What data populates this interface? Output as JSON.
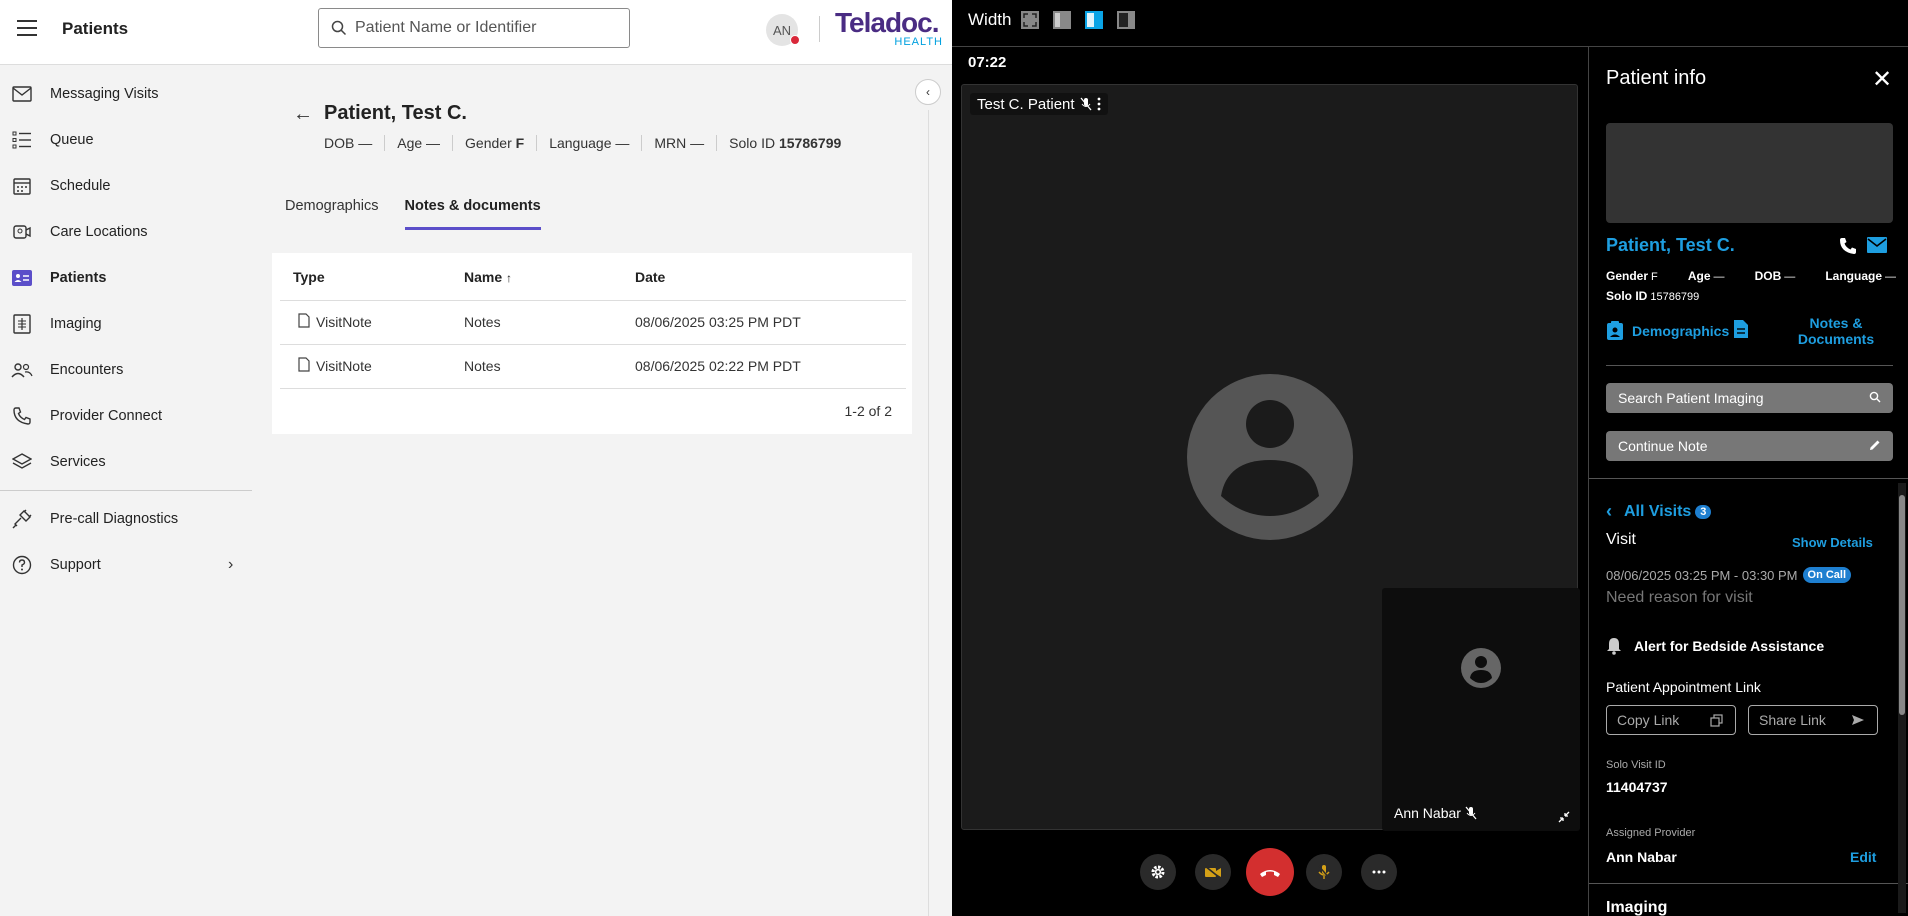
{
  "header": {
    "title": "Patients",
    "search_placeholder": "Patient Name or Identifier",
    "avatar_initials": "AN",
    "logo_main": "Teladoc.",
    "logo_sub": "HEALTH"
  },
  "sidebar": {
    "items": [
      {
        "label": "Messaging Visits",
        "icon": "mail-icon"
      },
      {
        "label": "Queue",
        "icon": "list-icon"
      },
      {
        "label": "Schedule",
        "icon": "calendar-icon"
      },
      {
        "label": "Care Locations",
        "icon": "location-icon"
      },
      {
        "label": "Patients",
        "icon": "id-card-icon",
        "active": true
      },
      {
        "label": "Imaging",
        "icon": "imaging-icon"
      },
      {
        "label": "Encounters",
        "icon": "people-icon"
      },
      {
        "label": "Provider Connect",
        "icon": "phone-icon"
      },
      {
        "label": "Services",
        "icon": "layers-icon"
      },
      {
        "label": "Pre-call Diagnostics",
        "icon": "plug-icon"
      },
      {
        "label": "Support",
        "icon": "help-icon"
      }
    ]
  },
  "patient": {
    "name": "Patient, Test C.",
    "meta": {
      "dob_label": "DOB",
      "dob_value": "—",
      "age_label": "Age",
      "age_value": "—",
      "gender_label": "Gender",
      "gender_value": "F",
      "language_label": "Language",
      "language_value": "—",
      "mrn_label": "MRN",
      "mrn_value": "—",
      "solo_label": "Solo ID",
      "solo_value": "15786799"
    }
  },
  "tabs": [
    {
      "label": "Demographics"
    },
    {
      "label": "Notes & documents",
      "active": true
    }
  ],
  "table": {
    "headers": {
      "type": "Type",
      "name": "Name",
      "date": "Date"
    },
    "sort_indicator": "↑",
    "rows": [
      {
        "type": "VisitNote",
        "name": "Notes",
        "date": "08/06/2025 03:25 PM PDT"
      },
      {
        "type": "VisitNote",
        "name": "Notes",
        "date": "08/06/2025 02:22 PM PDT"
      }
    ],
    "footer": "1-2 of 2"
  },
  "call": {
    "width_label": "Width",
    "timer": "07:22",
    "remote_name": "Test C. Patient",
    "self_name": "Ann Nabar"
  },
  "patient_info": {
    "title": "Patient info",
    "name": "Patient, Test C.",
    "gender_label": "Gender",
    "gender_value": "F",
    "age_label": "Age",
    "age_value": "—",
    "dob_label": "DOB",
    "dob_value": "—",
    "language_label": "Language",
    "language_value": "—",
    "solo_label": "Solo ID",
    "solo_value": "15786799",
    "demographics_link": "Demographics",
    "notes_link": "Notes & Documents",
    "search_imaging": "Search Patient Imaging",
    "continue_note": "Continue Note",
    "all_visits": "All Visits",
    "all_visits_count": "3",
    "visit_heading": "Visit",
    "show_details": "Show Details",
    "visit_time": "08/06/2025 03:25 PM - 03:30 PM",
    "visit_status": "On Call",
    "visit_reason": "Need reason for visit",
    "alert_label": "Alert for Bedside Assistance",
    "appointment_link_heading": "Patient Appointment Link",
    "copy_link": "Copy Link",
    "share_link": "Share Link",
    "solo_visit_label": "Solo Visit ID",
    "solo_visit_value": "11404737",
    "assigned_provider_label": "Assigned Provider",
    "assigned_provider_value": "Ann Nabar",
    "edit": "Edit",
    "imaging_heading": "Imaging"
  },
  "colors": {
    "accent_purple": "#5b4ec9",
    "link_blue": "#1e9ee0",
    "end_call_red": "#d32f2f"
  }
}
